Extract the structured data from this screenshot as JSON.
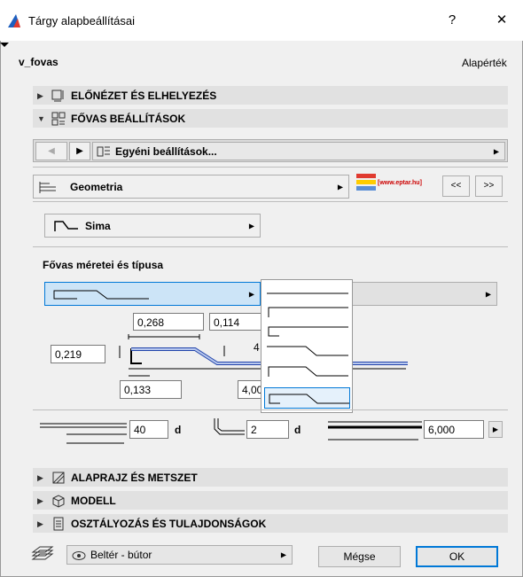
{
  "window": {
    "title": "Tárgy alapbeállításai",
    "help": "?",
    "close": "✕"
  },
  "header": {
    "object_name": "v_fovas",
    "default_label": "Alapérték"
  },
  "sections": {
    "preview": "ELŐNÉZET ÉS ELHELYEZÉS",
    "fovas_settings": "FŐVAS BEÁLLÍTÁSOK",
    "floorplan": "ALAPRAJZ ÉS METSZET",
    "model": "MODELL",
    "classification": "OSZTÁLYOZÁS ÉS TULAJDONSÁGOK"
  },
  "nav": {
    "custom_settings": "Egyéni beállítások..."
  },
  "geometry": {
    "label": "Geometria",
    "logo_text": "[www.eptar.hu]",
    "prev": "<<",
    "next": ">>"
  },
  "shape": {
    "label": "Sima"
  },
  "dimensions": {
    "heading": "Fővas méretei és típusa",
    "top_left": "0,268",
    "top_right": "0,114",
    "left_height": "0,219",
    "bottom_left": "0,133",
    "bottom_right": "4,00",
    "behind_text": "4"
  },
  "bottom_row": {
    "overlap": "40",
    "overlap_unit": "d",
    "bend": "2",
    "bend_unit": "d",
    "length": "6,000"
  },
  "footer": {
    "layer": "Beltér - bútor",
    "cancel": "Mégse",
    "ok": "OK"
  },
  "colors": {
    "accent": "#0078d7",
    "selected_bg": "#cce4f7",
    "logo_bar": "#ffcc00"
  }
}
